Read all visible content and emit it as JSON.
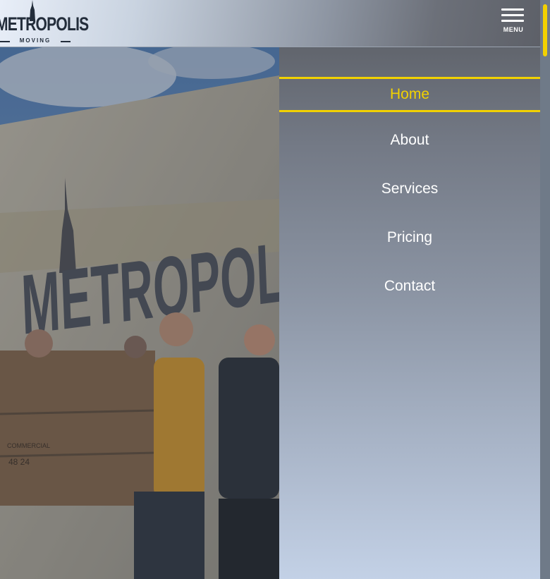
{
  "header": {
    "logo_word": "METROPOLIS",
    "logo_sub": "MOVING",
    "menu_label": "MENU",
    "menu_icon": "hamburger-icon"
  },
  "nav": {
    "items": [
      {
        "label": "Home",
        "active": true
      },
      {
        "label": "About"
      },
      {
        "label": "Services"
      },
      {
        "label": "Pricing"
      },
      {
        "label": "Contact"
      }
    ]
  },
  "hero": {
    "truck_lettering": "METROPOLIS",
    "box_text_1": "COMMERCIAL",
    "box_text_2": "48 24"
  },
  "colors": {
    "accent": "#f2d100",
    "logo": "#232d3b",
    "nav_text": "#ffffff"
  }
}
